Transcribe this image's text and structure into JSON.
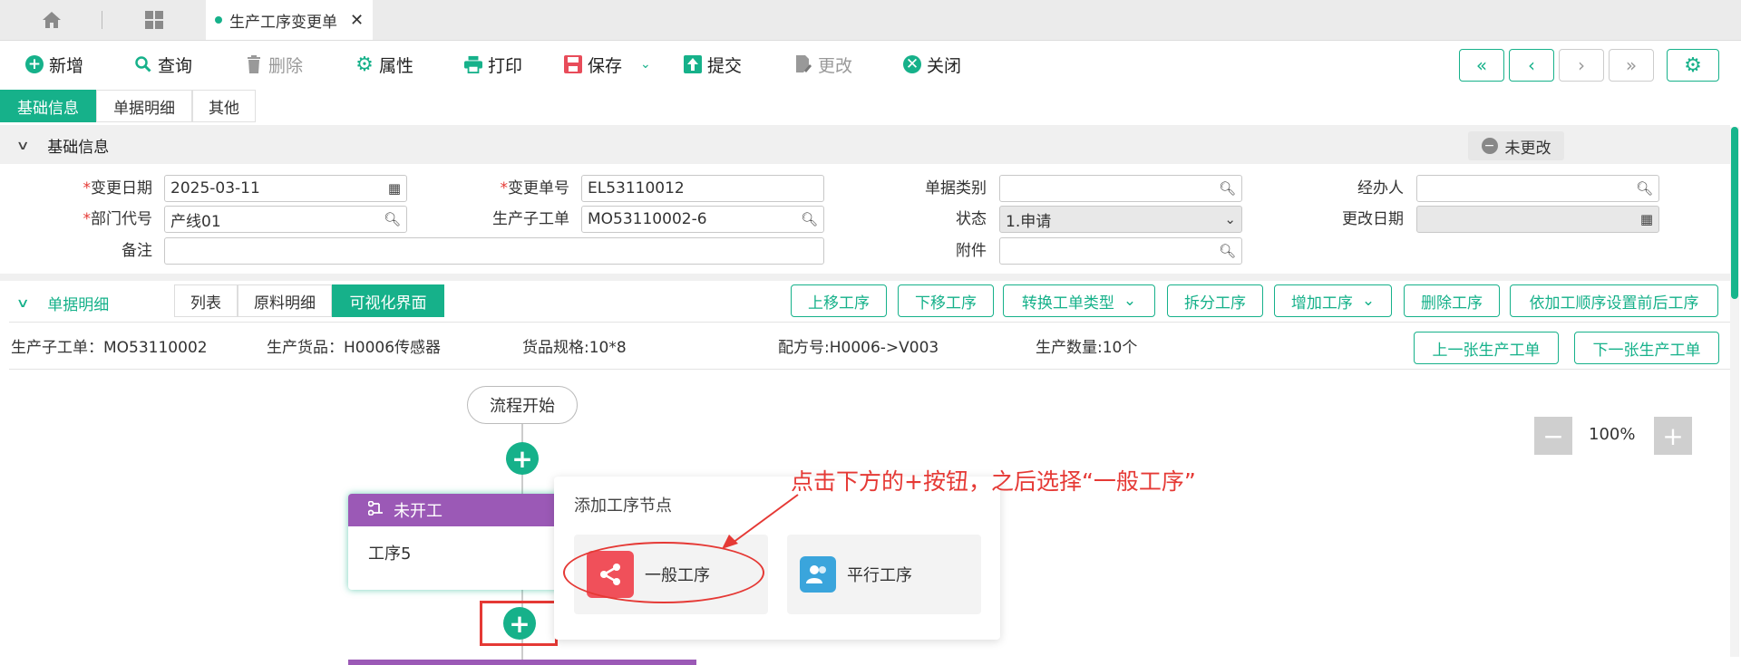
{
  "tabs": {
    "doc_title": "生产工序变更单"
  },
  "toolbar": {
    "new": "新增",
    "query": "查询",
    "delete": "删除",
    "property": "属性",
    "print": "打印",
    "save": "保存",
    "submit": "提交",
    "modify": "更改",
    "close": "关闭"
  },
  "subtabs": [
    "基础信息",
    "单据明细",
    "其他"
  ],
  "basic": {
    "section_title": "基础信息",
    "status_badge": "未更改",
    "change_date_label": "变更日期",
    "change_date": "2025-03-11",
    "change_no_label": "变更单号",
    "change_no": "EL53110012",
    "doc_type_label": "单据类别",
    "doc_type": "",
    "handler_label": "经办人",
    "handler": "",
    "dept_label": "部门代号",
    "dept": "产线01",
    "sub_order_label": "生产子工单",
    "sub_order": "MO53110002-6",
    "state_label": "状态",
    "state": "1.申请",
    "modify_date_label": "更改日期",
    "modify_date": "",
    "remark_label": "备注",
    "remark": "",
    "attach_label": "附件",
    "attach": ""
  },
  "detail": {
    "section_title": "单据明细",
    "view_tabs": [
      "列表",
      "原料明细",
      "可视化界面"
    ],
    "buttons": {
      "move_up": "上移工序",
      "move_down": "下移工序",
      "convert": "转换工单类型",
      "split": "拆分工序",
      "add": "增加工序",
      "remove": "删除工序",
      "reorder": "依加工顺序设置前后工序"
    },
    "info": {
      "sub_order": "生产子工单：MO53110002",
      "product": "生产货品：H0006传感器",
      "spec": "货品规格:10*8",
      "formula": "配方号:H0006->V003",
      "qty": "生产数量:10个"
    },
    "prev_order": "上一张生产工单",
    "next_order": "下一张生产工单",
    "zoom": "100%"
  },
  "flow": {
    "start": "流程开始",
    "node_status": "未开工",
    "node_name": "工序5"
  },
  "popup": {
    "title": "添加工序节点",
    "opt_general": "一般工序",
    "opt_parallel": "平行工序"
  },
  "annotation": "点击下方的+按钮，之后选择“一般工序”",
  "colors": {
    "accent": "#16b18a",
    "node_header": "#9b59b6",
    "annotation": "#e53935"
  }
}
